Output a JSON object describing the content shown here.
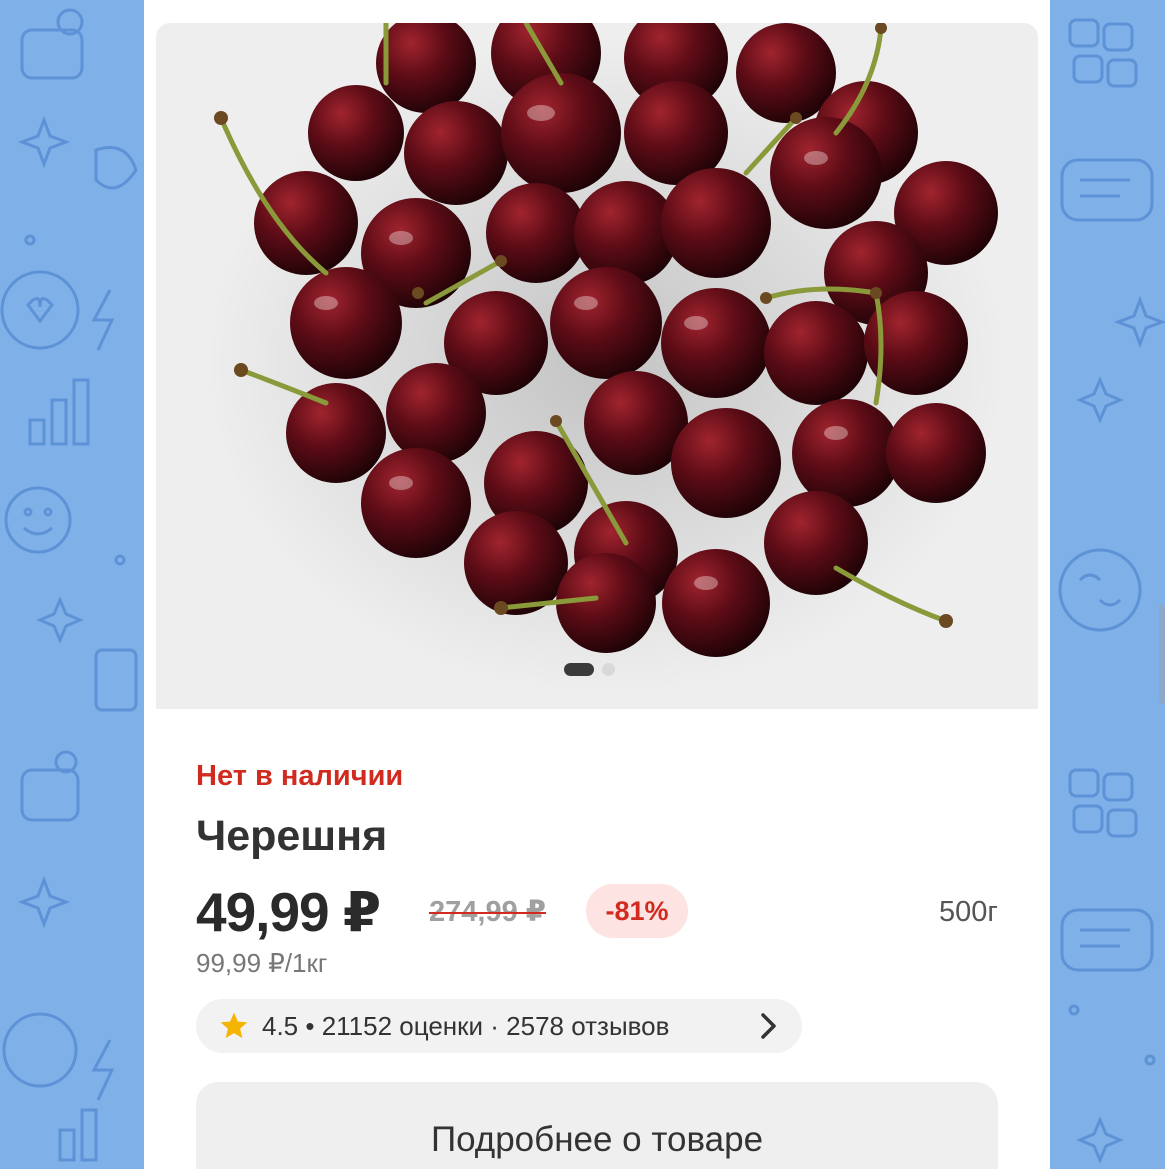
{
  "colors": {
    "background": "#7fb0e8",
    "accent_red": "#d12b1f",
    "discount_bg": "#fde3e1",
    "star": "#f5b400"
  },
  "product": {
    "image_icon": "cherries-photo",
    "carousel": {
      "total": 2,
      "active": 1
    },
    "stock_status": "Нет в наличии",
    "title": "Черешня",
    "price": "49,99 ₽",
    "old_price": "274,99 ₽",
    "discount": "-81%",
    "weight": "500г",
    "unit_price": "99,99 ₽/1кг"
  },
  "rating": {
    "icon": "star-icon",
    "text": "4.5 • 21152 оценки · 2578 отзывов",
    "chevron_icon": "chevron-right-icon"
  },
  "actions": {
    "details_label": "Подробнее о товаре"
  }
}
